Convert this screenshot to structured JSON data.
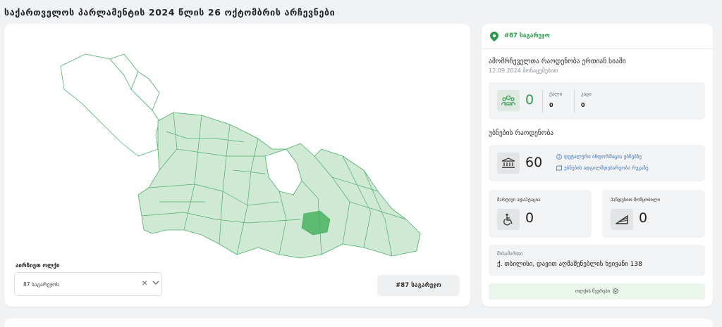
{
  "page": {
    "title": "საქართველოს პარლამენტის 2024 წლის 26 ოქტომბრის არჩევნები"
  },
  "map_panel": {
    "select_label": "აირჩიეთ ოლქი",
    "select_value": "87 საგარეჯოს",
    "clear_icon": "close-icon",
    "chevron_icon": "chevron-down-icon",
    "district_button": "#87 საგარეჯო",
    "map_colors": {
      "default": "#cfe9d4",
      "stroke": "#4caf6a",
      "selected": "#5cbb70",
      "excluded": "#ffffff"
    }
  },
  "info_panel": {
    "district_badge": "#87 საგარეჯო",
    "pin_icon": "map-pin-icon",
    "voters_title": "ამომრჩეველთა რაოდენობა ერთიან სიაში",
    "voters_date": "12.09.2024 მონაცემებით",
    "voters_total": "0",
    "female_label": "ქალი",
    "female_value": "0",
    "male_label": "კაცი",
    "male_value": "0",
    "precincts_title": "უბნების რაოდენობა",
    "precincts_value": "60",
    "link_detailed": "დეტალური ინფორმაცია უბნებზე",
    "link_map": "უბნების ადგილმდებარეობა რუკაზე",
    "ramp_label": "მარტივი ადაპტაცია",
    "ramp_value": "0",
    "pandus_label": "პანდუსით მოწყობილი",
    "pandus_value": "0",
    "address_label": "მისამართი",
    "address_value": "ქ. თბილისი, დავით აღმაშენებლის ხეივანი 138",
    "list_button": "ოლქის წევრები",
    "accent": "#2e9a4d"
  }
}
